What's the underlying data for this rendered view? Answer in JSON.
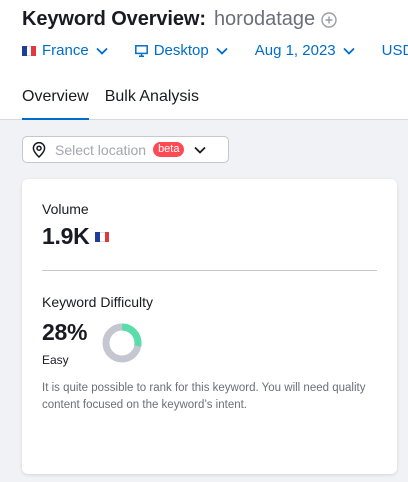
{
  "header": {
    "title": "Keyword Overview:",
    "keyword": "horodatage",
    "filters": {
      "country": "France",
      "device": "Desktop",
      "date": "Aug 1, 2023",
      "currency": "USD"
    },
    "tabs": [
      {
        "label": "Overview",
        "active": true
      },
      {
        "label": "Bulk Analysis",
        "active": false
      }
    ]
  },
  "location": {
    "placeholder": "Select location",
    "badge": "beta"
  },
  "card": {
    "volume_label": "Volume",
    "volume_value": "1.9K",
    "kd_label": "Keyword Difficulty",
    "kd_value": "28%",
    "kd_level": "Easy",
    "kd_percent": 28,
    "description": "It is quite possible to rank for this keyword. You will need quality content focused on the keyword’s intent."
  },
  "colors": {
    "accent": "#006dca",
    "beta_badge": "#ff4953",
    "donut_fill": "#59ddaa",
    "donut_track": "#c4c7cf"
  },
  "icons": {
    "add": "plus-circle-icon",
    "device": "desktop-icon",
    "location": "map-pin-icon",
    "dropdown": "chevron-down-icon",
    "country_flag": "france-flag-icon"
  }
}
